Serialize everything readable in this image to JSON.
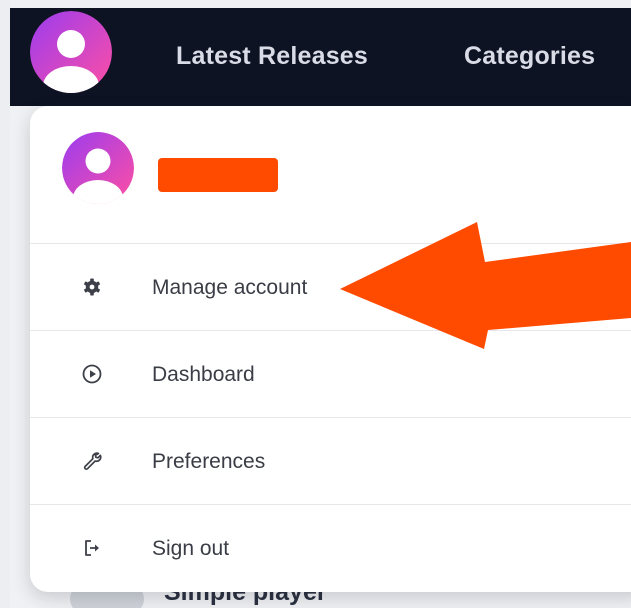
{
  "navbar": {
    "links": [
      "Latest Releases",
      "Categories"
    ]
  },
  "background": {
    "item_label": "Simple player"
  },
  "menu": {
    "items": [
      {
        "label": "Manage account",
        "icon": "gear-icon"
      },
      {
        "label": "Dashboard",
        "icon": "play-circle-icon"
      },
      {
        "label": "Preferences",
        "icon": "wrench-icon"
      },
      {
        "label": "Sign out",
        "icon": "sign-out-icon"
      }
    ]
  },
  "colors": {
    "navbar_bg": "#0e1324",
    "avatar_gradient_start": "#a43ee8",
    "avatar_gradient_end": "#ff4fa8",
    "redaction": "#ff4b00",
    "arrow": "#ff4b00"
  }
}
